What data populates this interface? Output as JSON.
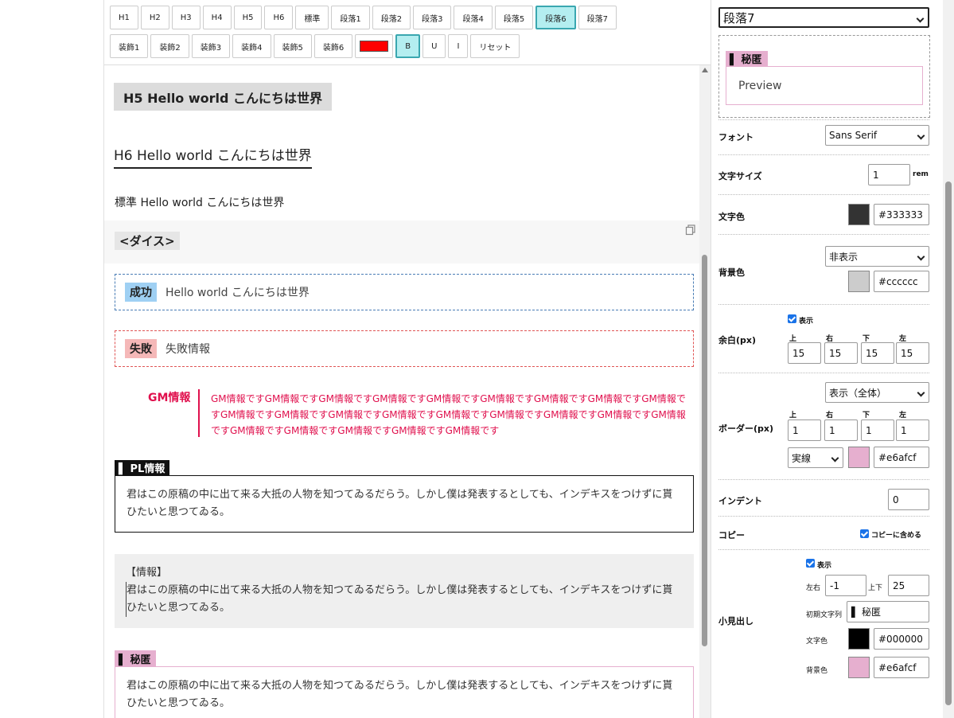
{
  "toolbar": {
    "row1": [
      "H1",
      "H2",
      "H3",
      "H4",
      "H5",
      "H6",
      "標準",
      "段落1",
      "段落2",
      "段落3",
      "段落4",
      "段落5",
      "段落6",
      "段落7"
    ],
    "row1_active": "段落6",
    "row2": [
      "装飾1",
      "装飾2",
      "装飾3",
      "装飾4",
      "装飾5",
      "装飾6"
    ],
    "color_swatch": "#ff0000",
    "bold": "B",
    "underline": "U",
    "italic": "I",
    "reset": "リセット"
  },
  "content": {
    "h5": "H5 Hello world こんにちは世界",
    "h6": "H6 Hello world こんにちは世界",
    "normal": "標準 Hello world こんにちは世界",
    "dice": "<ダイス>",
    "success_badge": "成功",
    "success_text": "Hello world こんにちは世界",
    "fail_badge": "失敗",
    "fail_text": "失敗情報",
    "gm_title": "GM情報",
    "gm_body": "GM情報ですGM情報ですGM情報ですGM情報ですGM情報ですGM情報ですGM情報ですGM情報ですGM情報ですGM情報ですGM情報ですGM情報ですGM情報ですGM情報ですGM情報ですGM情報ですGM情報ですGM情報ですGM情報ですGM情報ですGM情報ですGM情報ですGM情報です",
    "pl_title": "▌ PL情報",
    "pl_body": "君はこの原稿の中に出て来る大抵の人物を知つてゐるだらう。しかし僕は発表するとしても、インデキスをつけずに貰ひたいと思つてゐる。",
    "info_title": "【情報】",
    "info_body": "君はこの原稿の中に出て来る大抵の人物を知つてゐるだらう。しかし僕は発表するとしても、インデキスをつけずに貰ひたいと思つてゐる。",
    "secret_title": "▌ 秘匿",
    "secret_body": "君はこの原稿の中に出て来る大抵の人物を知つてゐるだらう。しかし僕は発表するとしても、インデキスをつけずに貰ひたいと思つてゐる。"
  },
  "panel": {
    "style_select": "段落7",
    "preview_heading": "▌ 秘匿",
    "preview_text": "Preview",
    "font_label": "フォント",
    "font_value": "Sans Serif",
    "size_label": "文字サイズ",
    "size_value": "1",
    "size_unit": "rem",
    "color_label": "文字色",
    "color_hex": "#333333",
    "bg_label": "背景色",
    "bg_mode": "非表示",
    "bg_hex": "#cccccc",
    "margin_label": "余白(px)",
    "margin_show": "表示",
    "dir_top": "上",
    "dir_right": "右",
    "dir_bottom": "下",
    "dir_left": "左",
    "margin_values": [
      "15",
      "15",
      "15",
      "15"
    ],
    "border_label": "ボーダー(px)",
    "border_mode": "表示（全体）",
    "border_values": [
      "1",
      "1",
      "1",
      "1"
    ],
    "border_style": "実線",
    "border_hex": "#e6afcf",
    "indent_label": "インデント",
    "indent_value": "0",
    "copy_label": "コピー",
    "copy_include": "コピーに含める",
    "heading_label": "小見出し",
    "heading_show": "表示",
    "lr_label": "左右",
    "lr_value": "-1",
    "ud_label": "上下",
    "ud_value": "25",
    "init_label": "初期文字列",
    "init_value": "▌ 秘匿",
    "h_color_label": "文字色",
    "h_color_hex": "#000000",
    "h_bg_label": "背景色",
    "h_bg_hex": "#e6afcf"
  },
  "colors": {
    "accent_active": "#b4eef0",
    "gm_red": "#e0114e",
    "success_blue": "#9fd0f3",
    "fail_pink": "#f5b8b8",
    "secret_pink": "#e6afcf",
    "text_dark": "#333333",
    "bg_gray": "#cccccc",
    "heading_black": "#000000"
  }
}
